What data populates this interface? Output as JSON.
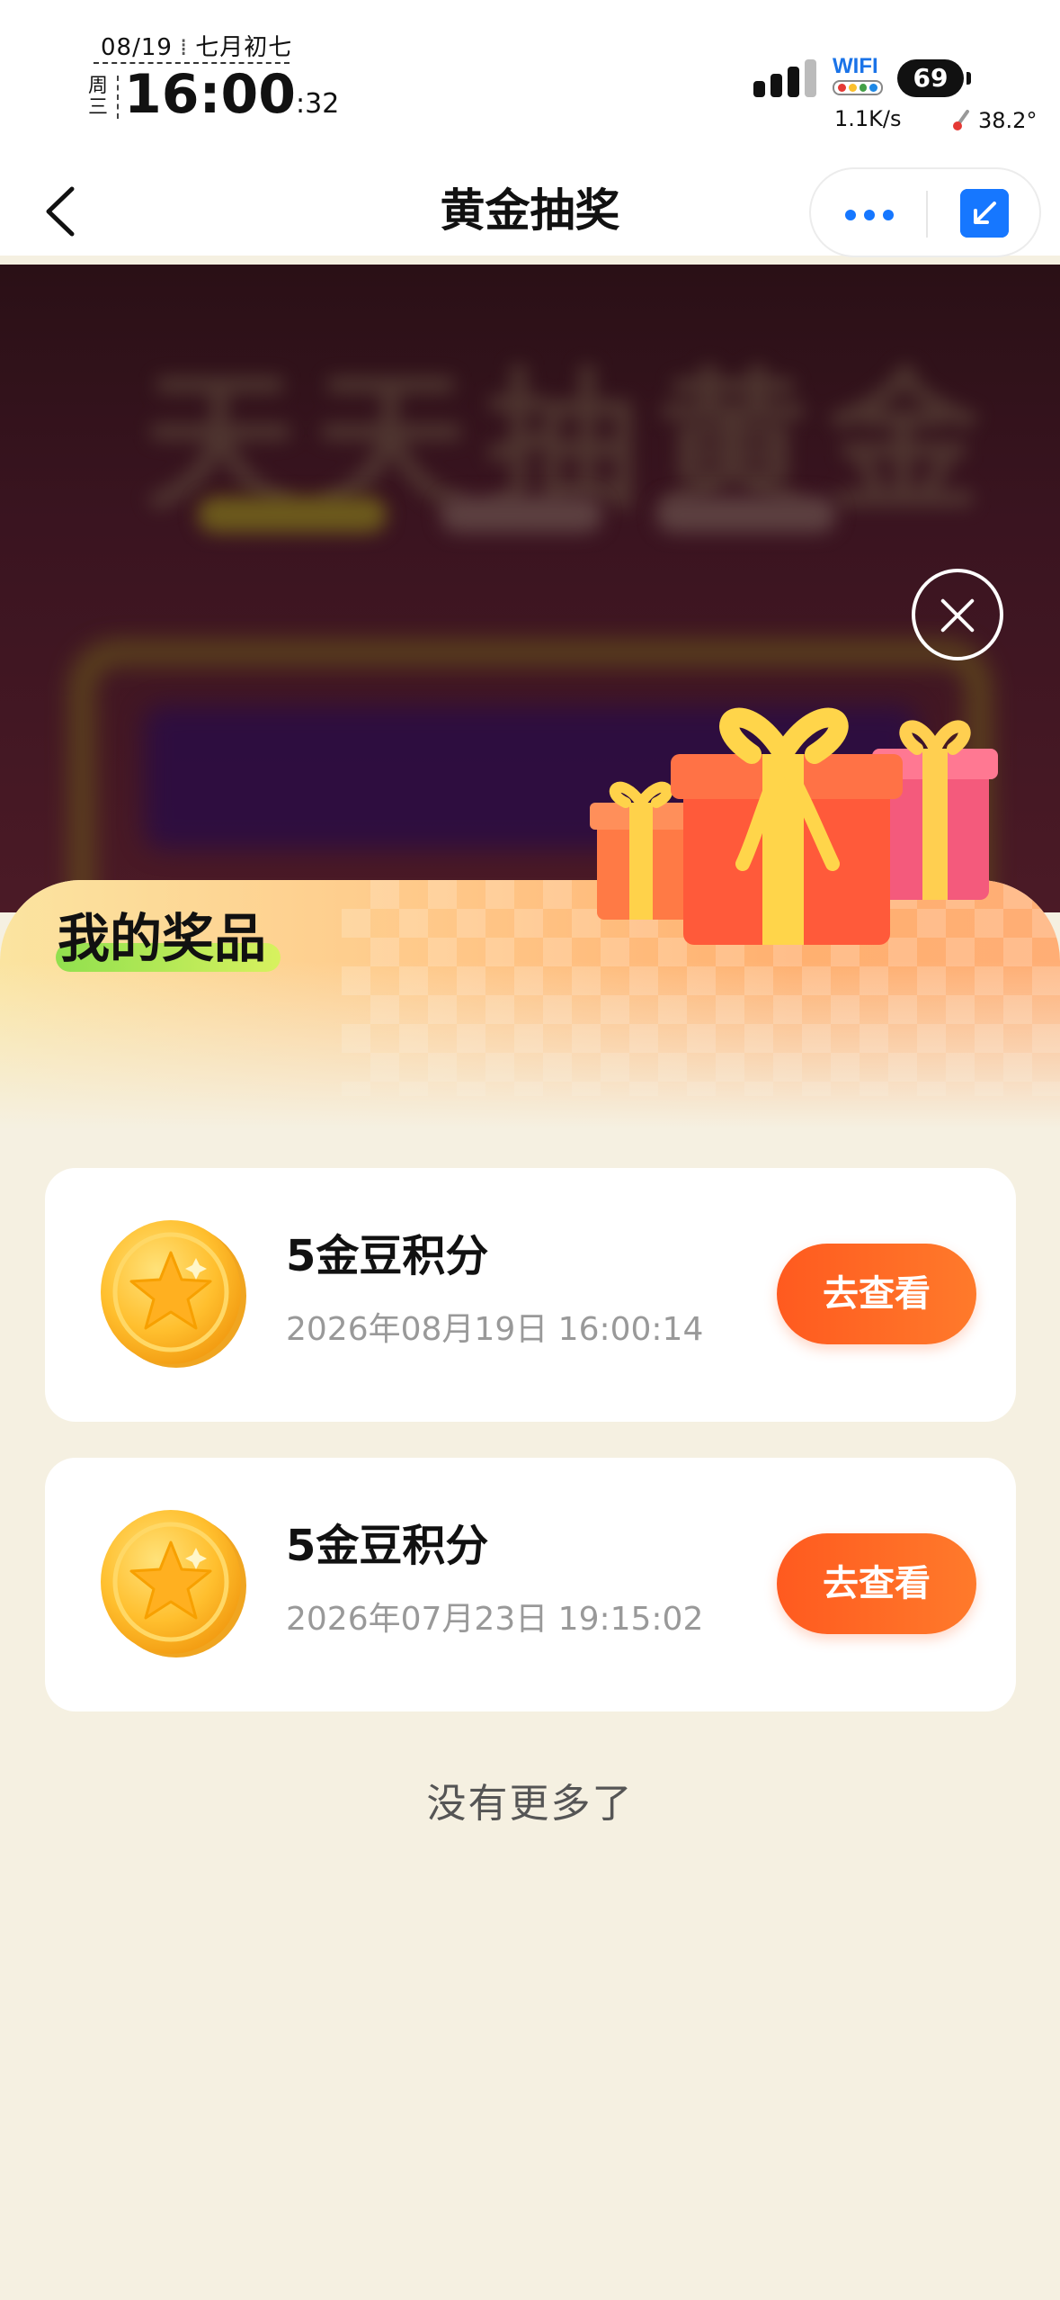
{
  "status_bar": {
    "date": "08/19",
    "lunar_date": "七月初七",
    "weekday": "周三",
    "time": "16:00",
    "seconds": ":32",
    "wifi_label": "WIFI",
    "battery": "69",
    "net_speed": "1.1K/s",
    "temperature": "38.2°"
  },
  "nav": {
    "title": "黄金抽奖"
  },
  "background": {
    "title": "天天抽黄金"
  },
  "sheet": {
    "title": "我的奖品",
    "prizes": [
      {
        "name": "5金豆积分",
        "time": "2026年08月19日 16:00:14",
        "button": "去查看"
      },
      {
        "name": "5金豆积分",
        "time": "2026年07月23日 19:15:02",
        "button": "去查看"
      }
    ],
    "footer": "没有更多了"
  },
  "colors": {
    "accent_blue": "#1677ff",
    "button_orange": "#ff6a22",
    "sheet_bg": "#f5f0e1"
  }
}
